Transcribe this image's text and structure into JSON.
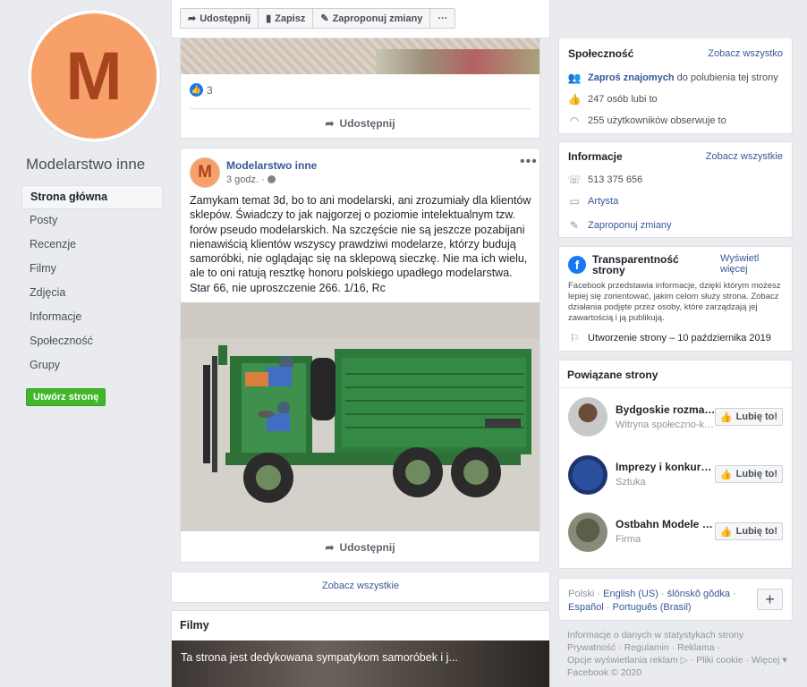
{
  "page": {
    "avatar_letter": "M",
    "name": "Modelarstwo inne",
    "create_button": "Utwórz stronę",
    "nav": [
      "Strona główna",
      "Posty",
      "Recenzje",
      "Filmy",
      "Zdjęcia",
      "Informacje",
      "Społeczność",
      "Grupy"
    ]
  },
  "actions": {
    "share": "Udostępnij",
    "save": "Zapisz",
    "suggest": "Zaproponuj zmiany",
    "more": "···"
  },
  "post1": {
    "likes": "3",
    "share": "Udostępnij"
  },
  "post2": {
    "author": "Modelarstwo inne",
    "avatar_letter": "M",
    "time": "3 godz. ·",
    "text": "Zamykam temat 3d, bo to ani modelarski, ani zrozumiały dla klientów sklepów. Świadczy to jak najgorzej o poziomie intelektualnym tzw. forów pseudo modelarskich. Na szczęście nie są jeszcze pozabijani nienawiścią klientów wszyscy prawdziwi modelarze, którzy budują samoróbki, nie oglądając się na sklepową sieczkę. Nie ma ich wielu, ale to oni ratują resztkę honoru polskiego upadłego modelarstwa.",
    "text2": "Star 66, nie uproszczenie 266. 1/16, Rc",
    "share": "Udostępnij"
  },
  "see_all": "Zobacz wszystkie",
  "films": {
    "title": "Filmy",
    "caption": "Ta strona jest dedykowana sympatykom samoróbek i j..."
  },
  "community": {
    "title": "Społeczność",
    "see_all": "Zobacz wszystko",
    "invite_link": "Zaproś znajomych",
    "invite_rest": " do polubienia tej strony",
    "likes": "247 osób lubi to",
    "follows": "255 użytkowników obserwuje to"
  },
  "info": {
    "title": "Informacje",
    "see_all": "Zobacz wszystkie",
    "phone": "513 375 656",
    "category": "Artysta",
    "suggest": "Zaproponuj zmiany"
  },
  "transparency": {
    "title": "Transparentność strony",
    "see_more": "Wyświetl więcej",
    "text": "Facebook przedstawia informacje, dzięki którym możesz lepiej się zorientować, jakim celom służy strona. Zobacz działania podjęte przez osoby, które zarządzają jej zawartością i ją publikują.",
    "created": "Utworzenie strony – 10 października 2019"
  },
  "related": {
    "title": "Powiązane strony",
    "like_label": "Lubię to!",
    "items": [
      {
        "name": "Bydgoskie rozmai...",
        "sub": "Witryna społeczno-ku..."
      },
      {
        "name": "Imprezy i konkurs...",
        "sub": "Sztuka"
      },
      {
        "name": "Ostbahn Modele K...",
        "sub": "Firma"
      }
    ]
  },
  "languages": {
    "l1": "Polski",
    "l2": "English (US)",
    "l3": "ślōnskŏ gŏdka",
    "l4": "Español",
    "l5": "Português (Brasil)",
    "plus": "+"
  },
  "footer": {
    "line1": "Informacje o danych w statystykach strony",
    "privacy": "Prywatność",
    "terms": "Regulamin",
    "ads": "Reklama",
    "adchoices": "Opcje wyświetlania reklam",
    "cookies": "Pliki cookie",
    "more": "Więcej",
    "copyright": "Facebook © 2020"
  }
}
